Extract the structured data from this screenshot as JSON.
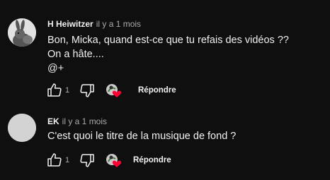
{
  "comments": [
    {
      "author": "H Heiwitzer",
      "date": "il y a 1 mois",
      "lines": [
        "Bon, Micka, quand est-ce que tu refais des vidéos ??",
        "On a hâte....",
        "@+"
      ],
      "likes": "1",
      "reply_label": "Répondre",
      "avatar_icon": "rabbit-avatar"
    },
    {
      "author": "EK",
      "date": "il y a 1 mois",
      "lines": [
        "C'est quoi le titre de la musique de fond ?"
      ],
      "likes": "1",
      "reply_label": "Répondre",
      "avatar_icon": "blank-avatar"
    }
  ],
  "colors": {
    "background": "#0f0f0f",
    "text": "#f1f1f1",
    "secondary": "#aaaaaa",
    "heart": "#ff0033"
  }
}
